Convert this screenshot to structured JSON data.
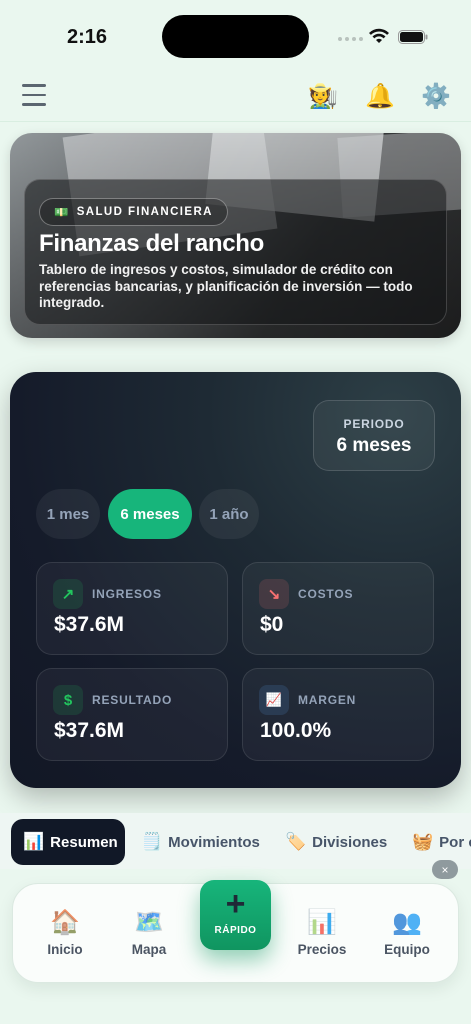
{
  "status_bar": {
    "time": "2:16"
  },
  "header": {
    "icons": [
      "farmer-icon",
      "bell-icon",
      "gear-icon"
    ],
    "farmer_glyph": "🧑‍🌾",
    "bell_glyph": "🔔",
    "gear_glyph": "⚙️"
  },
  "hero": {
    "badge_icon": "💵",
    "badge": "SALUD FINANCIERA",
    "title": "Finanzas del rancho",
    "description": "Tablero de ingresos y costos, simulador de crédito con referencias bancarias, y planificación de inversión — todo integrado."
  },
  "summary": {
    "period_label": "PERIODO",
    "period_value": "6 meses",
    "segments": [
      {
        "label": "1 mes",
        "active": false
      },
      {
        "label": "6 meses",
        "active": true
      },
      {
        "label": "1 año",
        "active": false
      }
    ],
    "kpis": [
      {
        "label": "INGRESOS",
        "value": "$37.6M",
        "icon": "↗",
        "color": "#22c55e"
      },
      {
        "label": "COSTOS",
        "value": "$0",
        "icon": "↘",
        "color": "#f87171"
      },
      {
        "label": "RESULTADO",
        "value": "$37.6M",
        "icon": "$",
        "color": "#22c55e"
      },
      {
        "label": "MARGEN",
        "value": "100.0%",
        "icon": "📈",
        "color": "#60a5fa"
      }
    ]
  },
  "tabs": [
    {
      "icon": "📊",
      "label": "Resumen",
      "active": true
    },
    {
      "icon": "🗒️",
      "label": "Movimientos",
      "active": false
    },
    {
      "icon": "🏷️",
      "label": "Divisiones",
      "active": false
    },
    {
      "icon": "🧺",
      "label": "Por c",
      "active": false
    }
  ],
  "close_label": "×",
  "bottom_nav": {
    "items": [
      {
        "icon": "🏠",
        "label": "Inicio"
      },
      {
        "icon": "🗺️",
        "label": "Mapa"
      },
      {
        "icon": "📊",
        "label": "Precios"
      },
      {
        "icon": "👥",
        "label": "Equipo"
      }
    ],
    "fab_icon": "+",
    "fab_label": "RÁPIDO"
  },
  "colors": {
    "accent": "#17b57b",
    "background": "#eaf7ef",
    "panel": "#151b2a"
  }
}
